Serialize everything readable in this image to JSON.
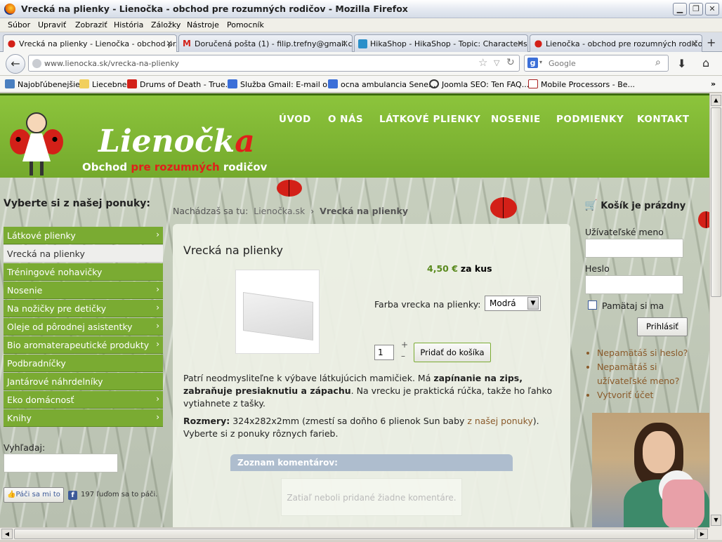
{
  "window": {
    "title": "Vrecká na plienky - Lienočka - obchod pre rozumných rodičov - Mozilla Firefox"
  },
  "menu": [
    "Súbor",
    "Upraviť",
    "Zobraziť",
    "História",
    "Záložky",
    "Nástroje",
    "Pomocník"
  ],
  "tabs": [
    {
      "label": "Vrecká na plienky - Lienočka - obchod pr..."
    },
    {
      "label": "Doručená pošta (1) - filip.trefny@gmail.c..."
    },
    {
      "label": "HikaShop - HikaShop - Topic: Characteris..."
    },
    {
      "label": "Lienočka - obchod pre rozumných rodičo..."
    }
  ],
  "address": {
    "host": "www.lienocka.sk",
    "path": "/vrecka-na-plienky"
  },
  "search": {
    "placeholder": "Google"
  },
  "bookmarks": [
    "Najobľúbenejšie",
    "Liecebne",
    "Drums of Death - True...",
    "Služba Gmail: E-mail o...",
    "ocna ambulancia Sene...",
    "Joomla SEO: Ten FAQ...",
    "Mobile Processors - Be..."
  ],
  "site": {
    "logo_main": "Lienočk",
    "logo_last": "a",
    "tagline_1": "Obchod",
    "tagline_2": "pre rozumných",
    "tagline_3": "rodičov",
    "nav": [
      "ÚVOD",
      "O NÁS",
      "LÁTKOVÉ PLIENKY",
      "NOSENIE",
      "PODMIENKY",
      "KONTAKT"
    ],
    "left_heading": "Vyberte si z našej ponuky:",
    "categories": [
      {
        "label": "Látkové plienky",
        "arrow": true
      },
      {
        "label": "Vrecká na plienky",
        "arrow": false,
        "active": true
      },
      {
        "label": "Tréningové nohavičky",
        "arrow": false
      },
      {
        "label": "Nosenie",
        "arrow": true
      },
      {
        "label": "Na nožičky pre detičky",
        "arrow": true
      },
      {
        "label": "Oleje od pôrodnej asistentky",
        "arrow": true
      },
      {
        "label": "Bio aromaterapeutické produkty",
        "arrow": true
      },
      {
        "label": "Podbradníčky",
        "arrow": false
      },
      {
        "label": "Jantárové náhrdelníky",
        "arrow": false
      },
      {
        "label": "Eko domácnosť",
        "arrow": true
      },
      {
        "label": "Knihy",
        "arrow": true
      }
    ],
    "search_label": "Vyhľadaj:",
    "like_button": "Páči sa mi to",
    "like_count": "197 ľuďom sa to páči.",
    "breadcrumb": {
      "prefix": "Nachádzaš sa tu:",
      "home": "Lienočka.sk",
      "sep": "›",
      "current": "Vrecká na plienky"
    },
    "product": {
      "title": "Vrecká na plienky",
      "price": "4,50 €",
      "price_unit": "za kus",
      "option_label": "Farba vrecka na plienky:",
      "option_value": "Modrá",
      "qty": "1",
      "add_to_cart": "Pridať do košíka",
      "desc_1": "Patrí neodmysliteľne k výbave látkujúcich mamičiek. Má ",
      "desc_bold": "zapínanie na zips, zabraňuje presiaknutiu a zápachu",
      "desc_2": ". Na vrecku je praktická rúčka, takže ho ľahko vytiahnete z tašky.",
      "dims_label": "Rozmery:",
      "dims_text": " 324x282x2mm (zmestí sa doňho 6 plienok Sun baby ",
      "dims_link": "z našej ponuky",
      "dims_end": "). Vyberte si z ponuky rôznych farieb.",
      "comments_title": "Zoznam komentárov:",
      "comments_empty": "Zatiaľ neboli pridané žiadne komentáre."
    },
    "cart_empty": "Košík je prázdny",
    "username_label": "Užívateľské meno",
    "password_label": "Heslo",
    "remember": "Pamätaj si ma",
    "login_button": "Prihlásiť",
    "links": [
      "Nepamätáš si heslo?",
      "Nepamätáš si užívateľské meno?",
      "Vytvoriť účet"
    ]
  },
  "colors": {
    "green": "#7aab32",
    "header": "#8cc43c",
    "red": "#d32018",
    "price": "#5a8a1e",
    "link": "#8a5a2a"
  }
}
